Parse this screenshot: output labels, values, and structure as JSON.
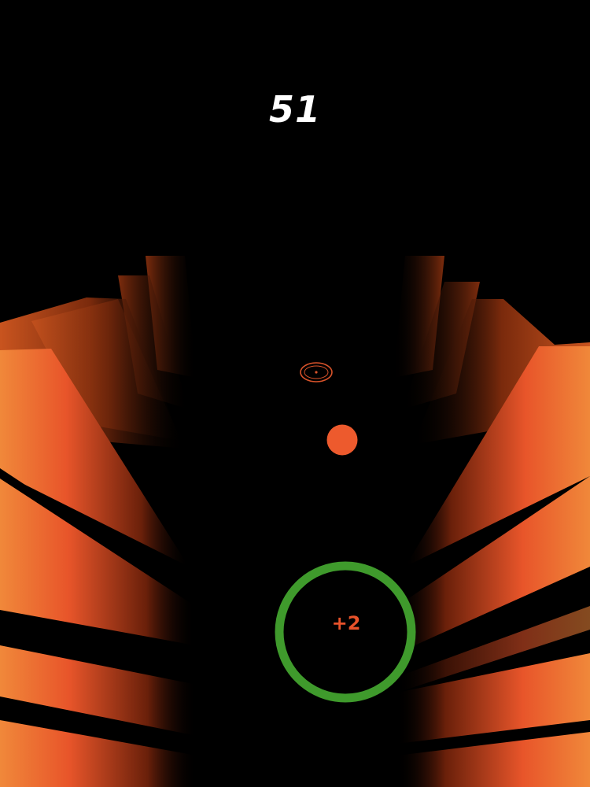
{
  "hud": {
    "score": "51"
  },
  "target_ring": {
    "label": "+2",
    "ring_color": "#3f9a2c",
    "label_color": "#e8522a"
  },
  "colors": {
    "background": "#000000",
    "wall_bright": "#f0883a",
    "wall_mid": "#e8552a",
    "wall_dark": "#6a200a",
    "ball": "#ed5a2d",
    "reticle": "#d9532a"
  },
  "icons": {
    "ball": "orange-ball",
    "reticle": "aim-reticle-icon",
    "target": "green-target-ring"
  }
}
